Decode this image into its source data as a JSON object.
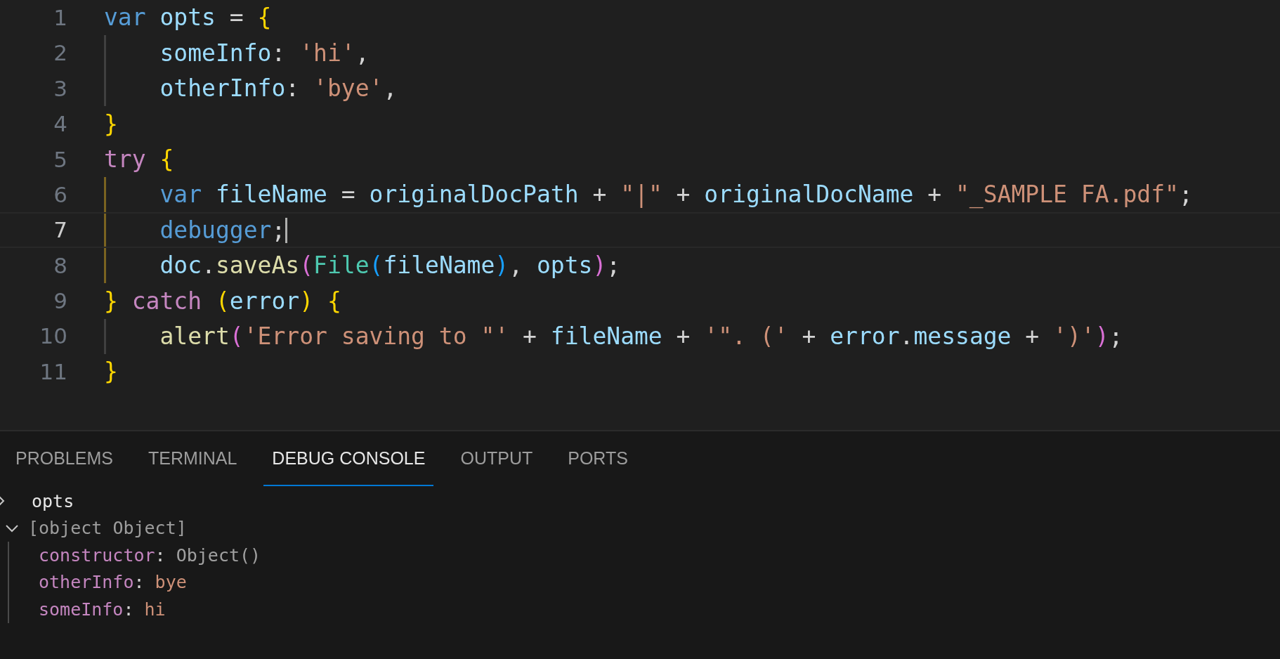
{
  "editor": {
    "lines": [
      {
        "number": "1",
        "current": false,
        "indented": false,
        "tokens": [
          {
            "text": "var ",
            "kind": "keyword"
          },
          {
            "text": "opts",
            "kind": "variable"
          },
          {
            "text": " = ",
            "kind": "punct"
          },
          {
            "text": "{",
            "kind": "bracket1"
          }
        ]
      },
      {
        "number": "2",
        "current": false,
        "indented": true,
        "active_guide": false,
        "tokens": [
          {
            "text": "someInfo",
            "kind": "variable"
          },
          {
            "text": ": ",
            "kind": "punct"
          },
          {
            "text": "'hi'",
            "kind": "string"
          },
          {
            "text": ",",
            "kind": "punct"
          }
        ]
      },
      {
        "number": "3",
        "current": false,
        "indented": true,
        "active_guide": false,
        "tokens": [
          {
            "text": "otherInfo",
            "kind": "variable"
          },
          {
            "text": ": ",
            "kind": "punct"
          },
          {
            "text": "'bye'",
            "kind": "string"
          },
          {
            "text": ",",
            "kind": "punct"
          }
        ]
      },
      {
        "number": "4",
        "current": false,
        "indented": false,
        "tokens": [
          {
            "text": "}",
            "kind": "bracket1"
          }
        ]
      },
      {
        "number": "5",
        "current": false,
        "indented": false,
        "tokens": [
          {
            "text": "try ",
            "kind": "control"
          },
          {
            "text": "{",
            "kind": "bracket1"
          }
        ]
      },
      {
        "number": "6",
        "current": false,
        "indented": true,
        "active_guide": true,
        "tokens": [
          {
            "text": "var ",
            "kind": "keyword"
          },
          {
            "text": "fileName",
            "kind": "variable"
          },
          {
            "text": " = ",
            "kind": "punct"
          },
          {
            "text": "originalDocPath",
            "kind": "variable"
          },
          {
            "text": " + ",
            "kind": "punct"
          },
          {
            "text": "\"|\"",
            "kind": "string"
          },
          {
            "text": " + ",
            "kind": "punct"
          },
          {
            "text": "originalDocName",
            "kind": "variable"
          },
          {
            "text": " + ",
            "kind": "punct"
          },
          {
            "text": "\"_SAMPLE FA.pdf\"",
            "kind": "string"
          },
          {
            "text": ";",
            "kind": "punct"
          }
        ]
      },
      {
        "number": "7",
        "current": true,
        "indented": true,
        "active_guide": true,
        "tokens": [
          {
            "text": "debugger",
            "kind": "keyword"
          },
          {
            "text": ";",
            "kind": "punct"
          }
        ]
      },
      {
        "number": "8",
        "current": false,
        "indented": true,
        "active_guide": true,
        "tokens": [
          {
            "text": "doc",
            "kind": "variable"
          },
          {
            "text": ".",
            "kind": "punct"
          },
          {
            "text": "saveAs",
            "kind": "function"
          },
          {
            "text": "(",
            "kind": "bracket2"
          },
          {
            "text": "File",
            "kind": "class"
          },
          {
            "text": "(",
            "kind": "bracket3"
          },
          {
            "text": "fileName",
            "kind": "variable"
          },
          {
            "text": ")",
            "kind": "bracket3"
          },
          {
            "text": ", ",
            "kind": "punct"
          },
          {
            "text": "opts",
            "kind": "variable"
          },
          {
            "text": ")",
            "kind": "bracket2"
          },
          {
            "text": ";",
            "kind": "punct"
          }
        ]
      },
      {
        "number": "9",
        "current": false,
        "indented": false,
        "tokens": [
          {
            "text": "} ",
            "kind": "bracket1"
          },
          {
            "text": "catch ",
            "kind": "control"
          },
          {
            "text": "(",
            "kind": "bracket1"
          },
          {
            "text": "error",
            "kind": "variable"
          },
          {
            "text": ") {",
            "kind": "bracket1"
          }
        ]
      },
      {
        "number": "10",
        "current": false,
        "indented": true,
        "active_guide": false,
        "tokens": [
          {
            "text": "alert",
            "kind": "function"
          },
          {
            "text": "(",
            "kind": "bracket2"
          },
          {
            "text": "'Error saving to \"'",
            "kind": "string"
          },
          {
            "text": " + ",
            "kind": "punct"
          },
          {
            "text": "fileName",
            "kind": "variable"
          },
          {
            "text": " + ",
            "kind": "punct"
          },
          {
            "text": "'\". ('",
            "kind": "string"
          },
          {
            "text": " + ",
            "kind": "punct"
          },
          {
            "text": "error",
            "kind": "variable"
          },
          {
            "text": ".",
            "kind": "punct"
          },
          {
            "text": "message",
            "kind": "variable"
          },
          {
            "text": " + ",
            "kind": "punct"
          },
          {
            "text": "')'",
            "kind": "string"
          },
          {
            "text": ")",
            "kind": "bracket2"
          },
          {
            "text": ";",
            "kind": "punct"
          }
        ]
      },
      {
        "number": "11",
        "current": false,
        "indented": false,
        "tokens": [
          {
            "text": "}",
            "kind": "bracket1"
          }
        ]
      }
    ]
  },
  "panel": {
    "tabs": [
      {
        "label": "PROBLEMS",
        "selected": false
      },
      {
        "label": "TERMINAL",
        "selected": false
      },
      {
        "label": "DEBUG CONSOLE",
        "selected": true
      },
      {
        "label": "OUTPUT",
        "selected": false
      },
      {
        "label": "PORTS",
        "selected": false
      }
    ],
    "console": [
      {
        "kind": "input",
        "text": "opts"
      },
      {
        "kind": "object",
        "text": "[object Object]",
        "expanded": true,
        "children": [
          {
            "key": "constructor",
            "separator": ":",
            "value": "Object()",
            "kind": "function"
          },
          {
            "key": "otherInfo",
            "separator": ":",
            "value": "bye",
            "kind": "string"
          },
          {
            "key": "someInfo",
            "separator": ":",
            "value": "hi",
            "kind": "string"
          }
        ]
      }
    ]
  }
}
